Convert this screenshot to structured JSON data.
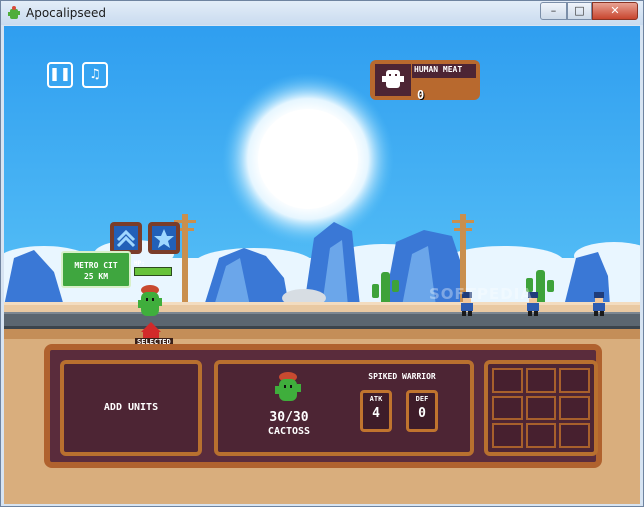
{
  "window": {
    "title": "Apocalipseed",
    "minimize_glyph": "–",
    "maximize_glyph": "□",
    "close_glyph": "✕"
  },
  "hud": {
    "pause_icon": "pause-icon",
    "music_icon": "music-icon",
    "pause_glyph": "❚❚",
    "music_glyph": "♫",
    "resource_label": "HUMAN MEAT",
    "resource_count": "0"
  },
  "scene": {
    "sign_line1": "METRO CIT",
    "sign_line2": "25 KM",
    "hp_label": "HP:",
    "hp_fraction": 1.0,
    "selected_label": "SELECTED",
    "watermark": "SOFTPEDIA"
  },
  "panel": {
    "add_units_label": "ADD UNITS",
    "unit_hp": "30/30",
    "unit_name": "CACTOSS",
    "unit_class": "SPIKED WARRIOR",
    "atk_label": "ATK",
    "atk_value": "4",
    "def_label": "DEF",
    "def_value": "0"
  },
  "colors": {
    "sky": "#3ba8f0",
    "panel_bg": "#5a2c3c",
    "panel_border": "#b0622e",
    "road": "#5b6670",
    "sand": "#e9c9a2"
  }
}
